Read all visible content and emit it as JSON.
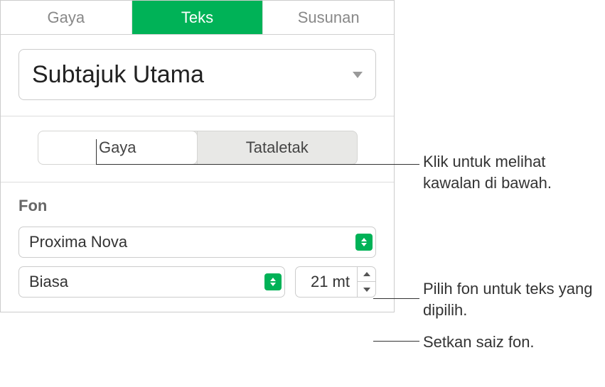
{
  "tabs": {
    "style": "Gaya",
    "text": "Teks",
    "arrange": "Susunan"
  },
  "paragraph_style": {
    "selected": "Subtajuk Utama"
  },
  "subtabs": {
    "style": "Gaya",
    "layout": "Tataletak"
  },
  "font": {
    "section_label": "Fon",
    "family": "Proxima Nova",
    "weight": "Biasa",
    "size": "21 mt"
  },
  "callouts": {
    "controls": "Klik untuk melihat kawalan di bawah.",
    "font_family": "Pilih fon untuk teks yang dipilih.",
    "font_size": "Setkan saiz fon."
  }
}
